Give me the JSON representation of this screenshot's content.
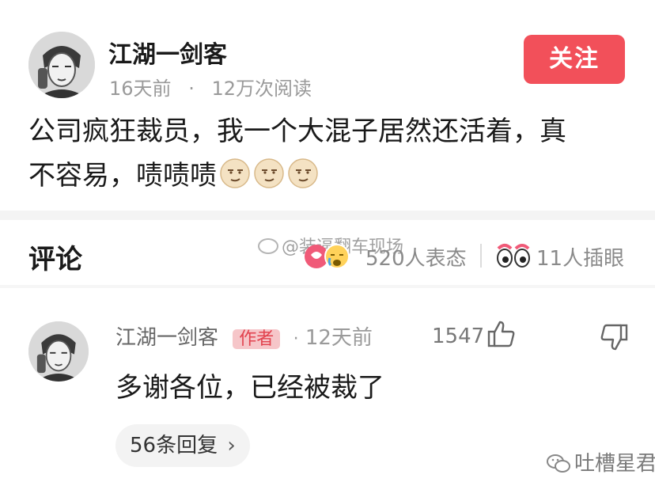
{
  "post": {
    "author": "江湖一剑客",
    "age": "16天前",
    "dot": "·",
    "views": "12万次阅读",
    "follow_label": "关注",
    "text_line1": "公司疯狂裁员，我一个大混子居然还活着，真",
    "text_line2": "不容易，啧啧啧"
  },
  "comments_header": {
    "title": "评论",
    "reactions_label": "520人表态",
    "eye_label": "11人插眼",
    "watermark": "@装逼翻车现场"
  },
  "comment": {
    "author": "江湖一剑客",
    "badge": "作者",
    "dot": "·",
    "age": "12天前",
    "likes": "1547",
    "text": "多谢各位，已经被裁了",
    "replies_label": "56条回复",
    "replies_chevron": "›"
  },
  "footer": {
    "brand": "吐槽星君"
  },
  "colors": {
    "accent": "#f2505a",
    "badge_bg": "#f6c6c9",
    "badge_text": "#e2434f"
  },
  "icons": [
    "avatar",
    "emoji-face-icon",
    "thumb-up-icon",
    "thumb-down-icon",
    "reaction-heart-icon",
    "eye-icon",
    "wechat-icon"
  ]
}
